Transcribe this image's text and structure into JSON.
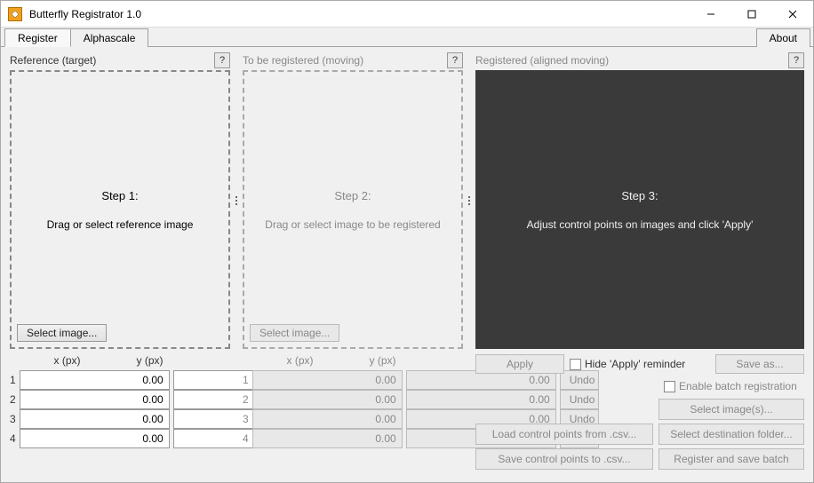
{
  "window": {
    "title": "Butterfly Registrator 1.0"
  },
  "tabs": {
    "register": "Register",
    "alphascale": "Alphascale",
    "about": "About"
  },
  "panels": {
    "reference": {
      "label": "Reference (target)",
      "help": "?",
      "step_title": "Step 1:",
      "step_desc": "Drag or select reference image",
      "select_btn": "Select image..."
    },
    "moving": {
      "label": "To be registered (moving)",
      "help": "?",
      "step_title": "Step 2:",
      "step_desc": "Drag or select image to be registered",
      "select_btn": "Select image..."
    },
    "registered": {
      "label": "Registered (aligned moving)",
      "help": "?",
      "step_title": "Step 3:",
      "step_desc": "Adjust control points on images and click 'Apply'"
    }
  },
  "coords": {
    "x_label": "x (px)",
    "y_label": "y (px)",
    "undo": "Undo",
    "rows": [
      {
        "idx": "1",
        "x": "0.00",
        "y": "0.00"
      },
      {
        "idx": "2",
        "x": "0.00",
        "y": "0.00"
      },
      {
        "idx": "3",
        "x": "0.00",
        "y": "0.00"
      },
      {
        "idx": "4",
        "x": "0.00",
        "y": "0.00"
      }
    ]
  },
  "controls": {
    "apply": "Apply",
    "hide_reminder": "Hide 'Apply' reminder",
    "save_as": "Save as...",
    "enable_batch": "Enable batch registration",
    "select_images": "Select image(s)...",
    "select_dest": "Select destination folder...",
    "register_batch": "Register and save batch",
    "load_csv": "Load control points from .csv...",
    "save_csv": "Save control points to .csv..."
  }
}
